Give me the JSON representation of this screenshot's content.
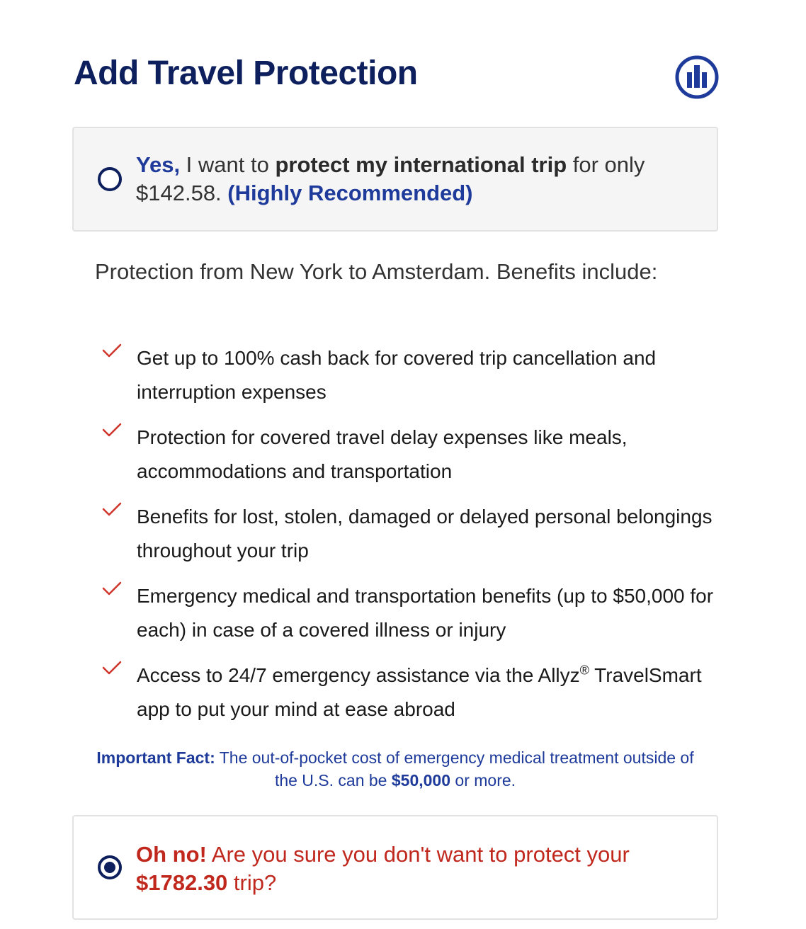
{
  "header": {
    "title": "Add Travel Protection",
    "logo_icon": "allianz-logo-icon"
  },
  "option_yes": {
    "selected": false,
    "lead": "Yes,",
    "text_1": " I want to ",
    "bold": "protect my international trip",
    "text_2": " for only $142.58. ",
    "recommend": "(Highly Recommended)"
  },
  "intro": "Protection from New York to Amsterdam. Benefits include:",
  "benefits": [
    {
      "icon": "checkmark-icon",
      "text": "Get up to 100% cash back for covered trip cancellation and interruption expenses"
    },
    {
      "icon": "checkmark-icon",
      "text": "Protection for covered travel delay expenses like meals, accommodations and transportation"
    },
    {
      "icon": "checkmark-icon",
      "text": "Benefits for lost, stolen, damaged or delayed personal belongings throughout your trip"
    },
    {
      "icon": "checkmark-icon",
      "text": "Emergency medical and transportation benefits (up to $50,000 for each) in case of a covered illness or injury"
    },
    {
      "icon": "checkmark-icon",
      "text_before": "Access to 24/7 emergency assistance via the Allyz",
      "sup": "®",
      "text_after": " TravelSmart app to put your mind at ease abroad"
    }
  ],
  "fact": {
    "label": "Important Fact:",
    "text_1": " The out-of-pocket cost of emergency medical treatment outside of the U.S. can be ",
    "amount": "$50,000",
    "text_2": " or more."
  },
  "option_no": {
    "selected": true,
    "lead": "Oh no!",
    "text_1": " Are you sure you don't want to protect your ",
    "amount": "$1782.30",
    "text_2": " trip?"
  },
  "colors": {
    "brand_navy": "#0d1f5c",
    "link_blue": "#1e3a9a",
    "check_red": "#d0352b",
    "warning_red": "#c0281e"
  }
}
